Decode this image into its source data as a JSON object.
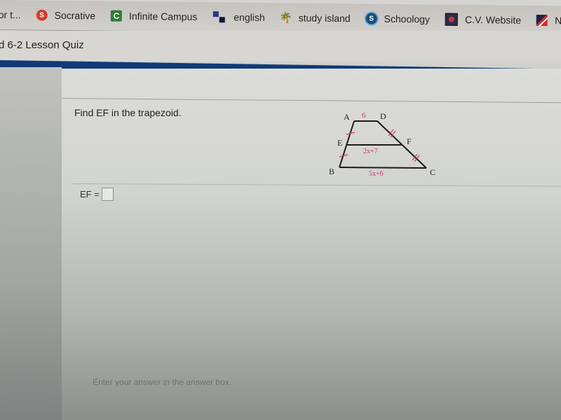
{
  "bookmarks": [
    {
      "label": "or t...",
      "icon": "truncated-bookmark"
    },
    {
      "label": "Socrative",
      "icon": "socrative-icon"
    },
    {
      "label": "Infinite Campus",
      "icon": "infinite-campus-icon"
    },
    {
      "label": "english",
      "icon": "english-icon"
    },
    {
      "label": "study island",
      "icon": "study-island-icon"
    },
    {
      "label": "Schoology",
      "icon": "schoology-icon"
    },
    {
      "label": "C.V. Website",
      "icon": "cv-website-icon"
    },
    {
      "label": "NFHS Lea",
      "icon": "nfhs-icon"
    }
  ],
  "quiz": {
    "title": "d 6-2 Lesson Quiz"
  },
  "question": {
    "prompt": "Find EF in the trapezoid.",
    "answer_label": "EF =",
    "answer_value": ""
  },
  "figure": {
    "vertices": {
      "A": "A",
      "D": "D",
      "E": "E",
      "F": "F",
      "B": "B",
      "C": "C"
    },
    "top_length": "6",
    "midsegment": "2x+7",
    "bottom_length": "5x+6",
    "label_color": "#d0347a",
    "line_color": "#1a1a1a"
  },
  "footer": {
    "hint": "Enter your answer in the answer box."
  }
}
